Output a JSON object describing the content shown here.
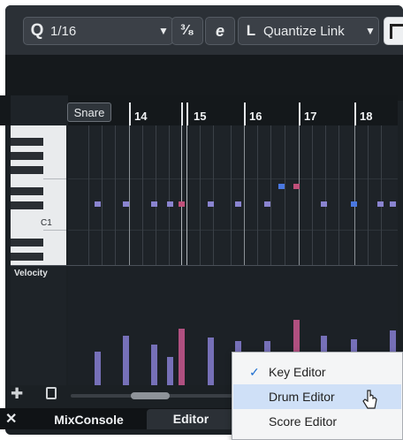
{
  "toolbar": {
    "quantize_icon": "Q",
    "quantize_value": "1/16",
    "dropdown_caret": "▼",
    "tuplet_symbol": "³⁄₈",
    "iterative_symbol": "e",
    "quantize_link_icon": "L",
    "quantize_link_label": "Quantize Link"
  },
  "ruler": {
    "bars": [
      "14",
      "15",
      "16",
      "17",
      "18"
    ]
  },
  "lane_tooltip": "Snare",
  "keys": {
    "c1_label": "C1"
  },
  "velocity_label": "Velocity",
  "tabs": {
    "close": "✕",
    "mixconsole": "MixConsole",
    "editor": "Editor"
  },
  "menu": {
    "check_mark": "✓",
    "items": [
      {
        "label": "Key Editor",
        "checked": true
      },
      {
        "label": "Drum Editor",
        "highlighted": true
      },
      {
        "label": "Score Editor"
      }
    ]
  },
  "colors": {
    "note": "#8a84d0",
    "note_selected_blue": "#4a78e0",
    "note_selected_red": "#c0507a",
    "menu_highlight": "#cfe0f7"
  }
}
